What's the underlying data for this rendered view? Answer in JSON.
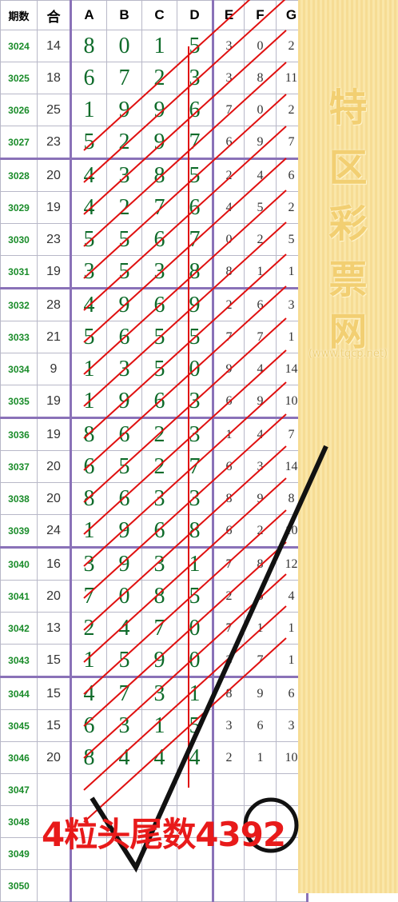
{
  "headers": [
    "期数",
    "合",
    "A",
    "B",
    "C",
    "D",
    "E",
    "F",
    "G"
  ],
  "rows": [
    {
      "issue": "3024",
      "sum": "14",
      "a": "8",
      "b": "0",
      "c": "1",
      "d": "5",
      "e": "3",
      "f": "0",
      "g": "2"
    },
    {
      "issue": "3025",
      "sum": "18",
      "a": "6",
      "b": "7",
      "c": "2",
      "d": "3",
      "e": "3",
      "f": "8",
      "g": "11"
    },
    {
      "issue": "3026",
      "sum": "25",
      "a": "1",
      "b": "9",
      "c": "9",
      "d": "6",
      "e": "7",
      "f": "0",
      "g": "2"
    },
    {
      "issue": "3027",
      "sum": "23",
      "a": "5",
      "b": "2",
      "c": "9",
      "d": "7",
      "e": "6",
      "f": "9",
      "g": "7"
    },
    {
      "issue": "3028",
      "sum": "20",
      "a": "4",
      "b": "3",
      "c": "8",
      "d": "5",
      "e": "2",
      "f": "4",
      "g": "6"
    },
    {
      "issue": "3029",
      "sum": "19",
      "a": "4",
      "b": "2",
      "c": "7",
      "d": "6",
      "e": "4",
      "f": "5",
      "g": "2"
    },
    {
      "issue": "3030",
      "sum": "23",
      "a": "5",
      "b": "5",
      "c": "6",
      "d": "7",
      "e": "0",
      "f": "2",
      "g": "5"
    },
    {
      "issue": "3031",
      "sum": "19",
      "a": "3",
      "b": "5",
      "c": "3",
      "d": "8",
      "e": "8",
      "f": "1",
      "g": "1"
    },
    {
      "issue": "3032",
      "sum": "28",
      "a": "4",
      "b": "9",
      "c": "6",
      "d": "9",
      "e": "2",
      "f": "6",
      "g": "3"
    },
    {
      "issue": "3033",
      "sum": "21",
      "a": "5",
      "b": "6",
      "c": "5",
      "d": "5",
      "e": "7",
      "f": "7",
      "g": "1"
    },
    {
      "issue": "3034",
      "sum": "9",
      "a": "1",
      "b": "3",
      "c": "5",
      "d": "0",
      "e": "9",
      "f": "4",
      "g": "14"
    },
    {
      "issue": "3035",
      "sum": "19",
      "a": "1",
      "b": "9",
      "c": "6",
      "d": "3",
      "e": "6",
      "f": "9",
      "g": "10"
    },
    {
      "issue": "3036",
      "sum": "19",
      "a": "8",
      "b": "6",
      "c": "2",
      "d": "3",
      "e": "1",
      "f": "4",
      "g": "7"
    },
    {
      "issue": "3037",
      "sum": "20",
      "a": "6",
      "b": "5",
      "c": "2",
      "d": "7",
      "e": "6",
      "f": "3",
      "g": "14"
    },
    {
      "issue": "3038",
      "sum": "20",
      "a": "8",
      "b": "6",
      "c": "3",
      "d": "3",
      "e": "8",
      "f": "9",
      "g": "8"
    },
    {
      "issue": "3039",
      "sum": "24",
      "a": "1",
      "b": "9",
      "c": "6",
      "d": "8",
      "e": "6",
      "f": "2",
      "g": "10"
    },
    {
      "issue": "3040",
      "sum": "16",
      "a": "3",
      "b": "9",
      "c": "3",
      "d": "1",
      "e": "7",
      "f": "8",
      "g": "12"
    },
    {
      "issue": "3041",
      "sum": "20",
      "a": "7",
      "b": "0",
      "c": "8",
      "d": "5",
      "e": "2",
      "f": "6",
      "g": "4"
    },
    {
      "issue": "3042",
      "sum": "13",
      "a": "2",
      "b": "4",
      "c": "7",
      "d": "0",
      "e": "7",
      "f": "1",
      "g": "1"
    },
    {
      "issue": "3043",
      "sum": "15",
      "a": "1",
      "b": "5",
      "c": "9",
      "d": "0",
      "e": "3",
      "f": "7",
      "g": "1"
    },
    {
      "issue": "3044",
      "sum": "15",
      "a": "4",
      "b": "7",
      "c": "3",
      "d": "1",
      "e": "8",
      "f": "9",
      "g": "6"
    },
    {
      "issue": "3045",
      "sum": "15",
      "a": "6",
      "b": "3",
      "c": "1",
      "d": "5",
      "e": "3",
      "f": "6",
      "g": "3"
    },
    {
      "issue": "3046",
      "sum": "20",
      "a": "8",
      "b": "4",
      "c": "4",
      "d": "4",
      "e": "2",
      "f": "1",
      "g": "10"
    },
    {
      "issue": "3047",
      "sum": "",
      "a": "",
      "b": "",
      "c": "",
      "d": "",
      "e": "",
      "f": "",
      "g": ""
    },
    {
      "issue": "3048",
      "sum": "",
      "a": "",
      "b": "",
      "c": "",
      "d": "",
      "e": "",
      "f": "",
      "g": ""
    },
    {
      "issue": "3049",
      "sum": "",
      "a": "",
      "b": "",
      "c": "",
      "d": "",
      "e": "",
      "f": "",
      "g": ""
    },
    {
      "issue": "3050",
      "sum": "",
      "a": "",
      "b": "",
      "c": "",
      "d": "",
      "e": "",
      "f": "",
      "g": ""
    }
  ],
  "watermark": {
    "chars": [
      "特",
      "区",
      "彩",
      "票",
      "网"
    ],
    "url": "(www.tqcp.net)"
  },
  "annotation": {
    "text": "4粒头尾数4392"
  },
  "colors": {
    "issue": "#1a8c2a",
    "main_digits": "#0e6b2a",
    "red_lines": "#e01010",
    "checkmark": "#111111",
    "note": "#e81a1a",
    "panel": "#f6dc94"
  }
}
